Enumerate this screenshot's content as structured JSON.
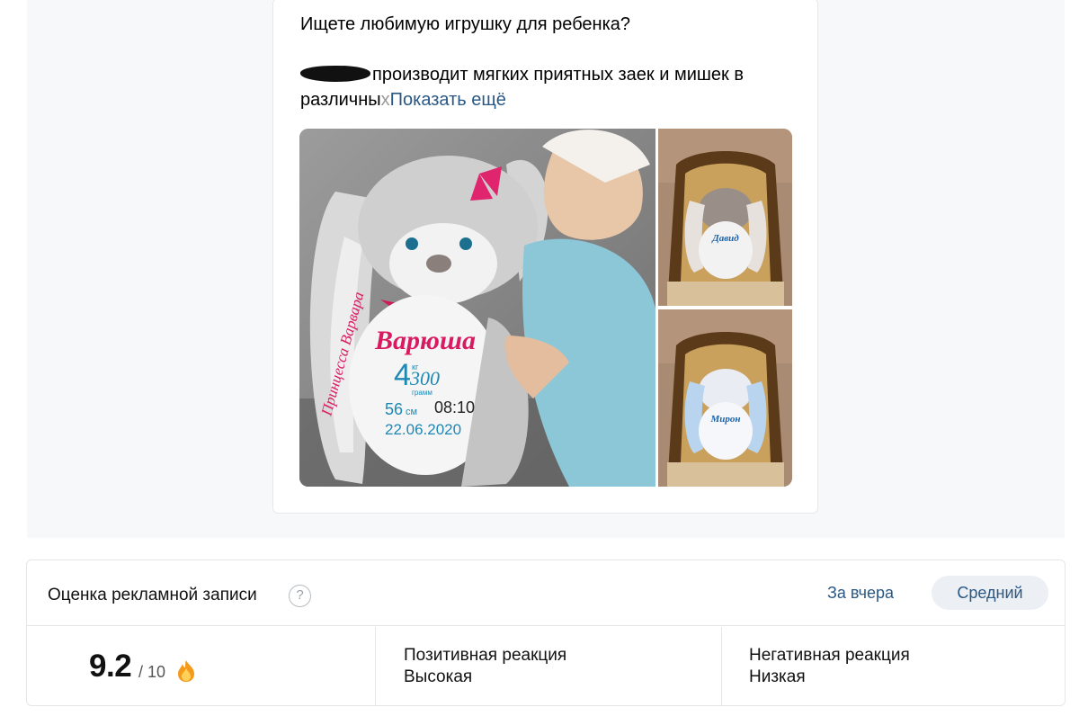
{
  "post": {
    "line1": "Ищете любимую игрушку для ребенка?",
    "line2_text": "производит мягких приятных заек и мишек в",
    "line3_text": "различны",
    "line3_fade": "х",
    "show_more": "Показать ещё",
    "photo_main": {
      "name_text": "Варюша",
      "ear_text": "Принцесса Варвара",
      "weight_kg": "4",
      "weight_g": "300",
      "weight_kg_unit": "кг",
      "weight_g_unit": "грамм",
      "height": "56",
      "height_unit": "см",
      "time": "08:10",
      "date": "22.06.2020"
    },
    "photo_side1": {
      "name_text": "Давид"
    },
    "photo_side2": {
      "name_text": "Мирон"
    }
  },
  "rating": {
    "title": "Оценка рекламной записи",
    "help_symbol": "?",
    "period_label": "За вчера",
    "level_label": "Средний",
    "score": "9.2",
    "score_max": "/ 10",
    "score_icon": "fire-icon",
    "positive_label": "Позитивная реакция",
    "positive_value": "Высокая",
    "negative_label": "Негативная реакция",
    "negative_value": "Низкая"
  },
  "colors": {
    "link": "#2a5885",
    "pill_bg": "#eceff3",
    "border": "#e4e6ea",
    "background": "#f7f8fa"
  }
}
